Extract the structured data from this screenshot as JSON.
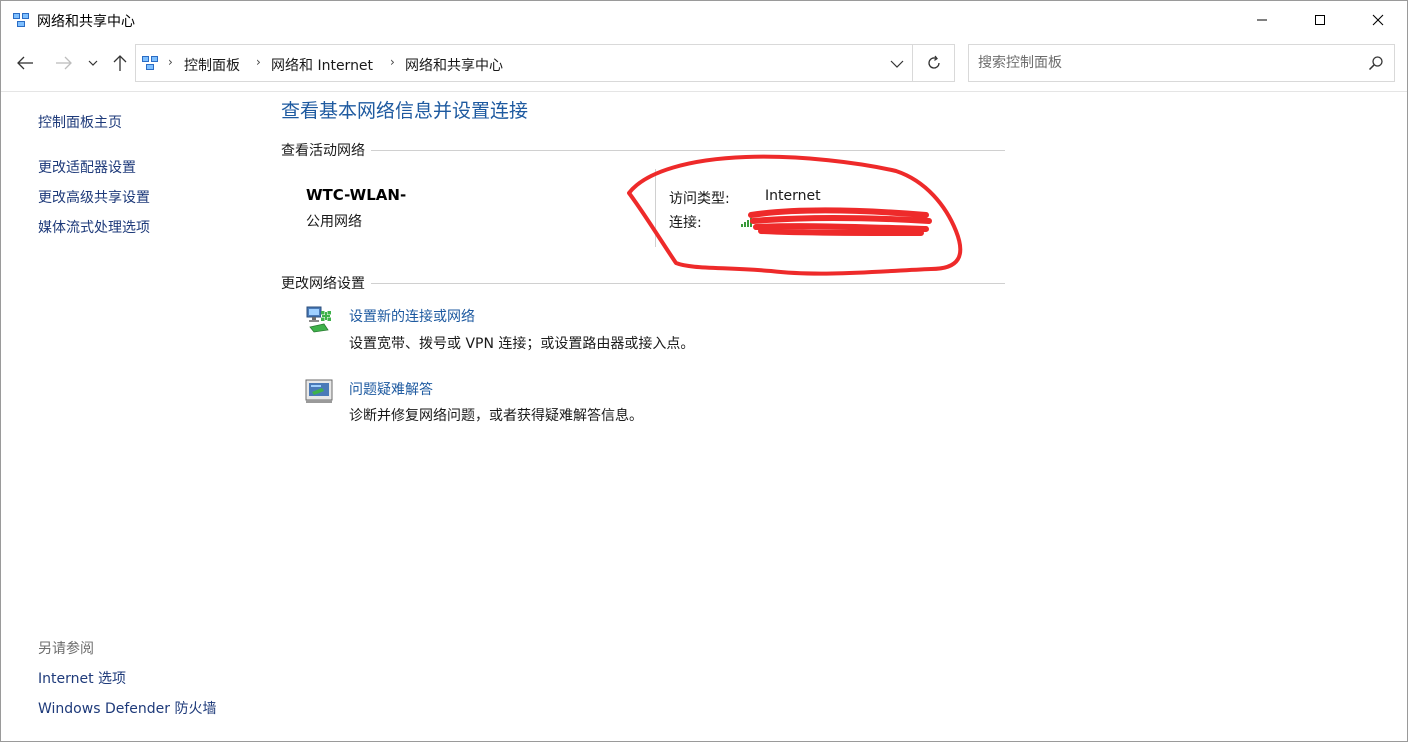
{
  "window": {
    "title": "网络和共享中心"
  },
  "nav": {
    "breadcrumbs": [
      "控制面板",
      "网络和 Internet",
      "网络和共享中心"
    ],
    "search_placeholder": "搜索控制面板"
  },
  "left_pane": {
    "home": "控制面板主页",
    "links": [
      "更改适配器设置",
      "更改高级共享设置",
      "媒体流式处理选项"
    ],
    "see_also_title": "另请参阅",
    "see_also": [
      "Internet 选项",
      "Windows Defender 防火墙"
    ]
  },
  "main": {
    "title": "查看基本网络信息并设置连接",
    "active_section": "查看活动网络",
    "network": {
      "name": "WTC-WLAN-",
      "category": "公用网络",
      "access_type_label": "访问类型:",
      "access_type_value": "Internet",
      "connection_label": "连接:"
    },
    "change_section": "更改网络设置",
    "tasks": [
      {
        "link": "设置新的连接或网络",
        "desc": "设置宽带、拨号或 VPN 连接；或设置路由器或接入点。",
        "icon": "network-setup-icon"
      },
      {
        "link": "问题疑难解答",
        "desc": "诊断并修复网络问题，或者获得疑难解答信息。",
        "icon": "troubleshoot-icon"
      }
    ]
  },
  "colors": {
    "link": "#1e5aa0",
    "annotation": "#ee2a2a"
  }
}
